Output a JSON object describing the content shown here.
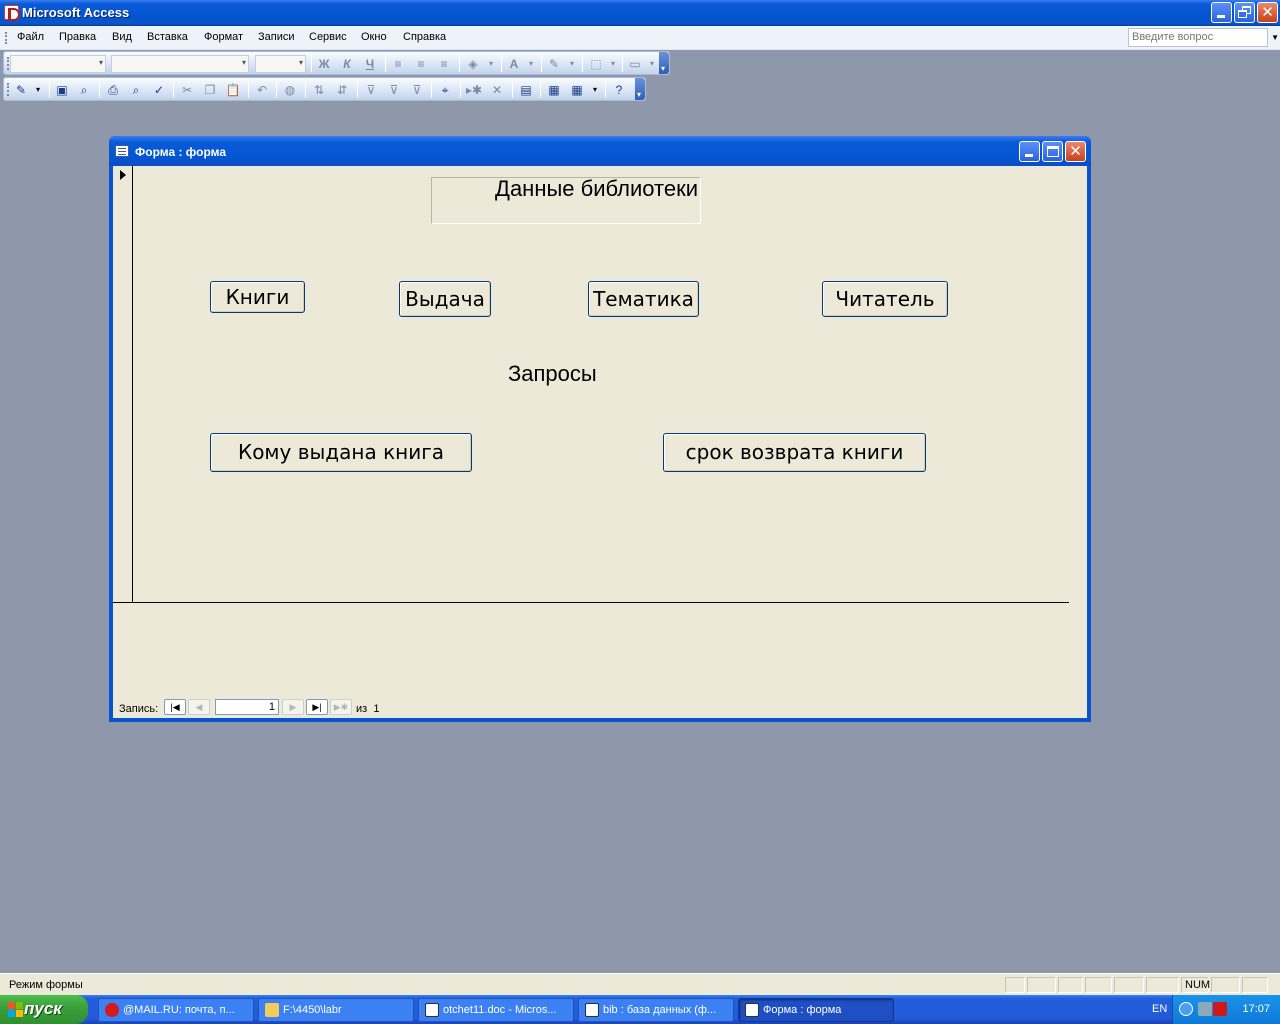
{
  "app": {
    "title": "Microsoft Access",
    "menu": [
      "Файл",
      "Правка",
      "Вид",
      "Вставка",
      "Формат",
      "Записи",
      "Сервис",
      "Окно",
      "Справка"
    ],
    "help_placeholder": "Введите вопрос"
  },
  "format_toolbar": {
    "bold": "Ж",
    "italic": "К",
    "underline": "Ч"
  },
  "form": {
    "window_title": "Форма : форма",
    "heading": "Данные библиотеки",
    "buttons": [
      "Книги",
      "Выдача",
      "Тематика",
      "Читатель"
    ],
    "queries_label": "Запросы",
    "query_buttons": [
      "Кому выдана книга",
      "срок возврата книги"
    ],
    "record_nav": {
      "label": "Запись:",
      "current": "1",
      "of_label": "из",
      "total": "1"
    }
  },
  "statusbar": {
    "mode": "Режим формы",
    "num": "NUM"
  },
  "taskbar": {
    "start": "пуск",
    "tasks": [
      "@MAIL.RU: почта, п...",
      "F:\\4450\\labr",
      "otchet11.doc - Micros...",
      "bib : база данных (ф...",
      "Форма : форма"
    ],
    "lang": "EN",
    "clock": "17:07"
  }
}
